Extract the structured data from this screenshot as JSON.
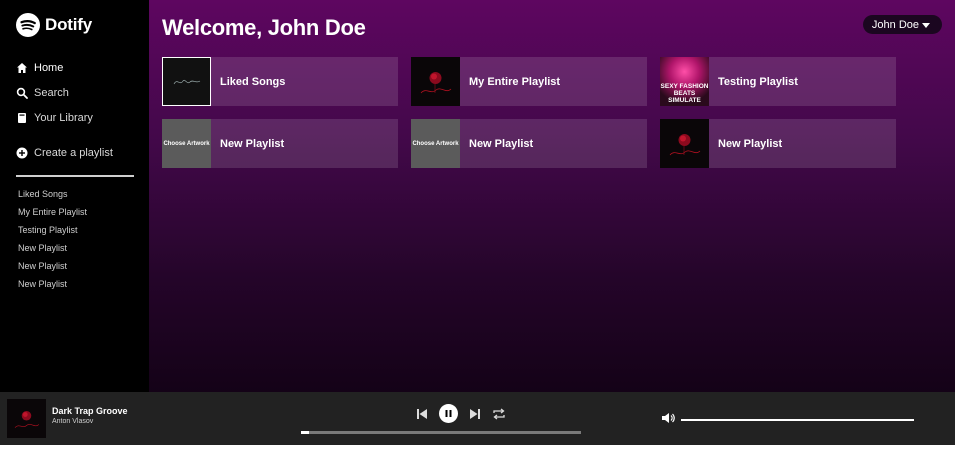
{
  "app": {
    "name": "Dotify"
  },
  "sidebar": {
    "nav": [
      {
        "label": "Home",
        "icon": "home-icon"
      },
      {
        "label": "Search",
        "icon": "search-icon"
      },
      {
        "label": "Your Library",
        "icon": "library-icon"
      }
    ],
    "create_label": "Create a playlist",
    "playlists": [
      "Liked Songs",
      "My Entire Playlist",
      "Testing Playlist",
      "New Playlist",
      "New Playlist",
      "New Playlist"
    ]
  },
  "header": {
    "welcome": "Welcome, John Doe",
    "user_menu": "John Doe"
  },
  "cards": [
    {
      "title": "Liked Songs",
      "art": "liked"
    },
    {
      "title": "My Entire Playlist",
      "art": "rose"
    },
    {
      "title": "Testing Playlist",
      "art": "testing",
      "art_text": "SEXY FASHION BEATS SIMULATE"
    },
    {
      "title": "New Playlist",
      "art": "choose",
      "art_text": "Choose Artwork"
    },
    {
      "title": "New Playlist",
      "art": "choose",
      "art_text": "Choose Artwork"
    },
    {
      "title": "New Playlist",
      "art": "rose"
    }
  ],
  "player": {
    "track_title": "Dark Trap Groove",
    "artist": "Anton Vlasov",
    "progress_fraction": 0.03,
    "volume_fraction": 1.0
  },
  "colors": {
    "accent": "#5e0660",
    "player_bg": "#222222"
  }
}
